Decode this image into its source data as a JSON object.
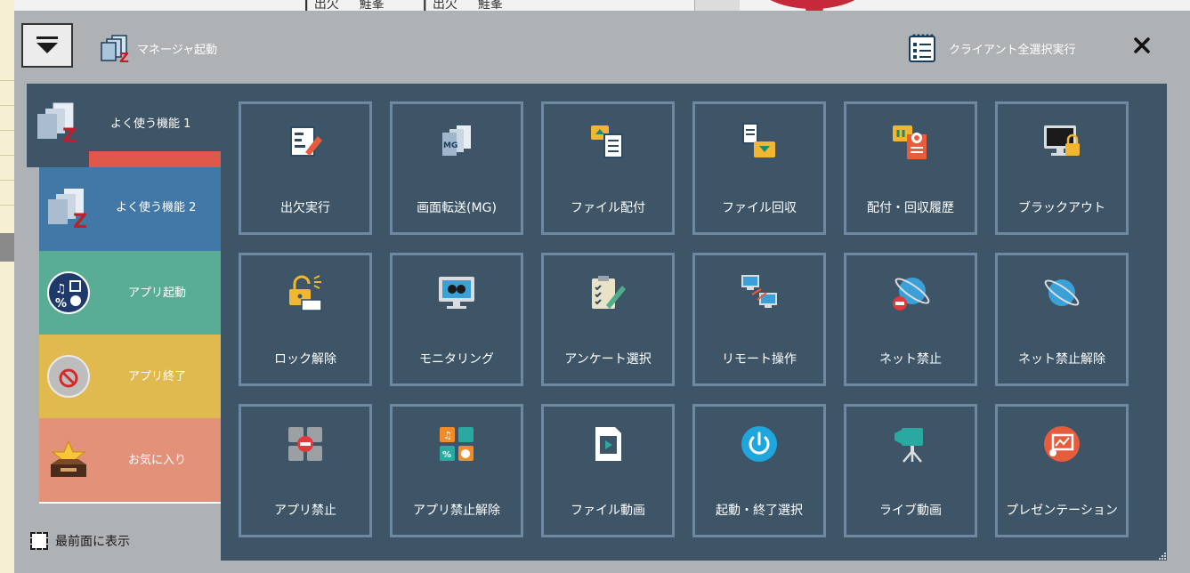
{
  "background": {
    "top_text": "┃ 出欠 　 鮭峯 　 　 ┃ 出欠 　 鮭峯"
  },
  "header": {
    "menu_icon": "dropdown-arrow-icon",
    "title": "マネージャ起動",
    "exec_label": "クライアント全選択実行",
    "close_label": "✕"
  },
  "tabs": [
    {
      "label": "よく使う機能 1",
      "color": "#3e5467",
      "active": true
    },
    {
      "label": "よく使う機能 2",
      "color": "#4278a8"
    },
    {
      "label": "アプリ起動",
      "color": "#5aad95"
    },
    {
      "label": "アプリ終了",
      "color": "#e0b94f"
    },
    {
      "label": "お気に入り",
      "color": "#e4917a"
    }
  ],
  "footer": {
    "always_on_top_label": "最前面に表示"
  },
  "grid": {
    "rows": [
      [
        {
          "label": "出欠実行",
          "icon": "attendance-icon"
        },
        {
          "label": "画面転送(MG)",
          "icon": "screen-transfer-icon"
        },
        {
          "label": "ファイル配付",
          "icon": "file-distribute-icon"
        },
        {
          "label": "ファイル回収",
          "icon": "file-collect-icon"
        },
        {
          "label": "配付・回収履歴",
          "icon": "history-icon"
        },
        {
          "label": "ブラックアウト",
          "icon": "blackout-icon"
        }
      ],
      [
        {
          "label": "ロック解除",
          "icon": "unlock-icon"
        },
        {
          "label": "モニタリング",
          "icon": "monitoring-icon"
        },
        {
          "label": "アンケート選択",
          "icon": "survey-icon"
        },
        {
          "label": "リモート操作",
          "icon": "remote-control-icon"
        },
        {
          "label": "ネット禁止",
          "icon": "net-block-icon"
        },
        {
          "label": "ネット禁止解除",
          "icon": "net-unblock-icon"
        }
      ],
      [
        {
          "label": "アプリ禁止",
          "icon": "app-block-icon"
        },
        {
          "label": "アプリ禁止解除",
          "icon": "app-unblock-icon"
        },
        {
          "label": "ファイル動画",
          "icon": "file-video-icon"
        },
        {
          "label": "起動・終了選択",
          "icon": "power-icon"
        },
        {
          "label": "ライブ動画",
          "icon": "live-video-icon"
        },
        {
          "label": "プレゼンテーション",
          "icon": "presentation-icon"
        }
      ]
    ]
  }
}
